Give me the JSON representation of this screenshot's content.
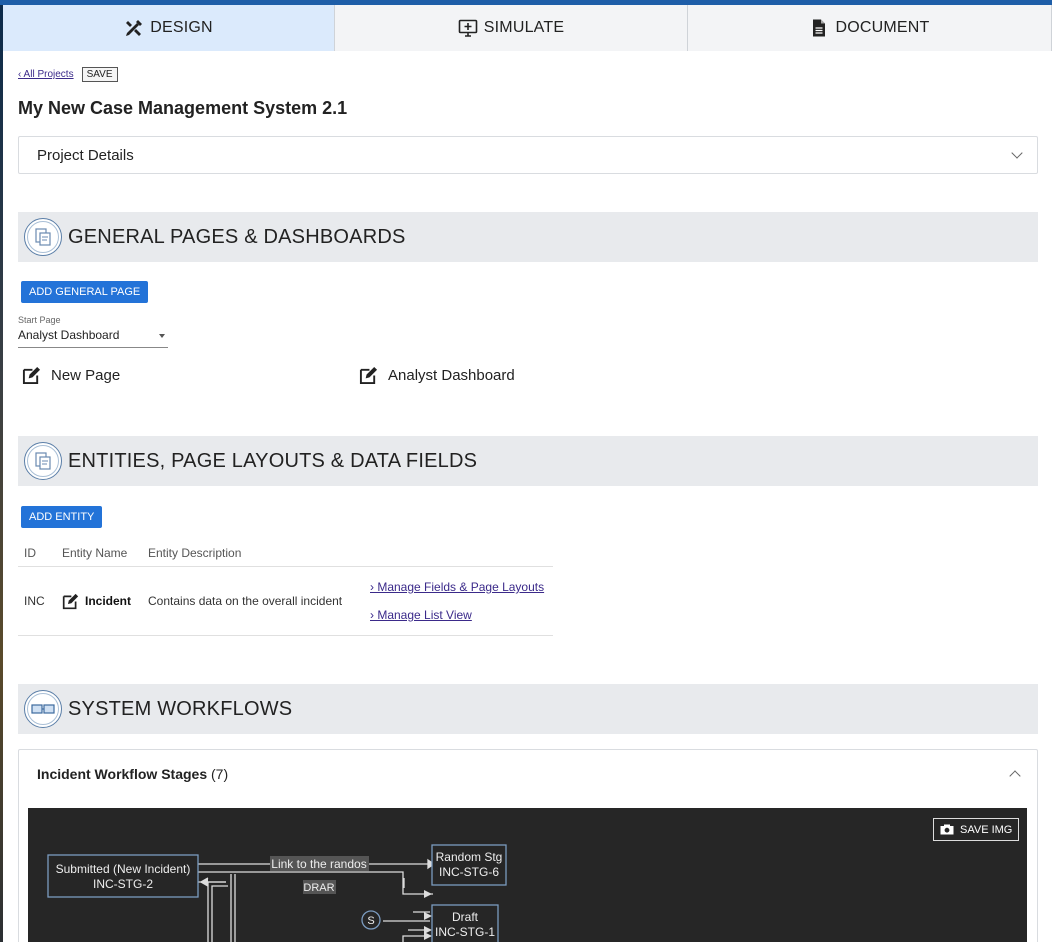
{
  "tabs": [
    {
      "label": "DESIGN",
      "icon": "design-tools-icon",
      "active": true
    },
    {
      "label": "SIMULATE",
      "icon": "simulate-monitor-icon",
      "active": false
    },
    {
      "label": "DOCUMENT",
      "icon": "document-icon",
      "active": false
    }
  ],
  "breadcrumb": {
    "back_link": "‹ All Projects",
    "save_label": "SAVE"
  },
  "project_title": "My New Case Management System 2.1",
  "project_details": {
    "label": "Project Details"
  },
  "general_pages": {
    "heading": "GENERAL PAGES & DASHBOARDS",
    "add_button": "ADD GENERAL PAGE",
    "start_page_label": "Start Page",
    "start_page_value": "Analyst Dashboard",
    "pages": [
      "New Page",
      "Analyst Dashboard"
    ]
  },
  "entities": {
    "heading": "ENTITIES, PAGE LAYOUTS & DATA FIELDS",
    "add_button": "ADD ENTITY",
    "columns": [
      "ID",
      "Entity Name",
      "Entity Description"
    ],
    "rows": [
      {
        "id": "INC",
        "name": "Incident",
        "description": "Contains data on the overall incident",
        "links": [
          "› Manage Fields & Page Layouts",
          "› Manage List View"
        ]
      }
    ]
  },
  "workflows": {
    "heading": "SYSTEM WORKFLOWS",
    "panel_title": "Incident Workflow Stages",
    "panel_count": "(7)",
    "save_img_label": "SAVE IMG",
    "nodes": [
      {
        "title": "Submitted (New Incident)",
        "id": "INC-STG-2"
      },
      {
        "title": "Random Stg",
        "id": "INC-STG-6"
      },
      {
        "title": "Draft",
        "id": "INC-STG-1"
      }
    ],
    "edge_labels": [
      "Link to the randos",
      "DRAR"
    ],
    "start_marker": "S"
  },
  "colors": {
    "accent": "#2373d8",
    "active_tab": "#dbeafc",
    "section_bg": "#e8eaed",
    "canvas_bg": "#262626",
    "top_bar": "#1e5ea8"
  }
}
